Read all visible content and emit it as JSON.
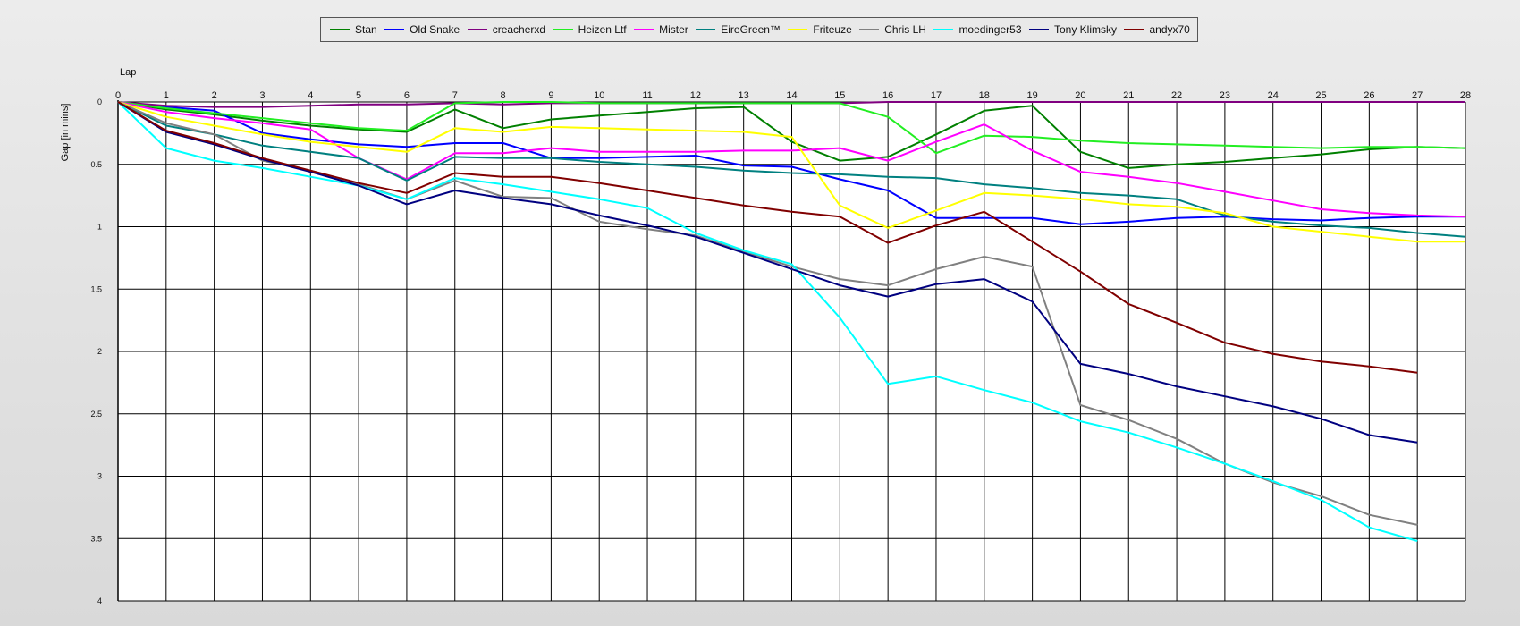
{
  "chart_data": {
    "type": "line",
    "title": "",
    "xlabel": "Lap",
    "ylabel": "Gap [in mins]",
    "xlim": [
      0,
      28
    ],
    "ylim": [
      0,
      4
    ],
    "y_inverted": true,
    "grid": true,
    "legend_position": "top",
    "x_ticks": [
      "0",
      "1",
      "2",
      "3",
      "4",
      "5",
      "6",
      "7",
      "8",
      "9",
      "10",
      "11",
      "12",
      "13",
      "14",
      "15",
      "16",
      "17",
      "18",
      "19",
      "20",
      "21",
      "22",
      "23",
      "24",
      "25",
      "26",
      "27",
      "28"
    ],
    "y_ticks": [
      "0",
      "0.5",
      "1",
      "1.5",
      "2",
      "2.5",
      "3",
      "3.5",
      "4"
    ],
    "series": [
      {
        "name": "Stan",
        "color": "#008000",
        "x": [
          0,
          1,
          2,
          3,
          4,
          5,
          6,
          7,
          8,
          9,
          10,
          11,
          12,
          13,
          14,
          15,
          16,
          17,
          18,
          19,
          20,
          21,
          22,
          23,
          24,
          25,
          26,
          27,
          28
        ],
        "values": [
          0,
          0.06,
          0.1,
          0.15,
          0.19,
          0.22,
          0.24,
          0.06,
          0.21,
          0.14,
          0.11,
          0.08,
          0.05,
          0.04,
          0.32,
          0.47,
          0.44,
          0.26,
          0.07,
          0.03,
          0.4,
          0.53,
          0.5,
          0.48,
          0.45,
          0.42,
          0.38,
          0.36,
          0.37
        ]
      },
      {
        "name": "Old Snake",
        "color": "#0000FF",
        "x": [
          0,
          1,
          2,
          3,
          4,
          5,
          6,
          7,
          8,
          9,
          10,
          11,
          12,
          13,
          14,
          15,
          16,
          17,
          18,
          19,
          20,
          21,
          22,
          23,
          24,
          25,
          26,
          27,
          28
        ],
        "values": [
          0,
          0.04,
          0.07,
          0.25,
          0.3,
          0.34,
          0.36,
          0.33,
          0.33,
          0.45,
          0.45,
          0.44,
          0.43,
          0.51,
          0.52,
          0.62,
          0.71,
          0.93,
          0.93,
          0.93,
          0.98,
          0.96,
          0.93,
          0.92,
          0.94,
          0.95,
          0.93,
          0.92,
          0.92
        ]
      },
      {
        "name": "creacherxd",
        "color": "#800080",
        "x": [
          0,
          1,
          2,
          3,
          4,
          5,
          6,
          7,
          8,
          9,
          10,
          11,
          12,
          13,
          14,
          15,
          16,
          17,
          18,
          19,
          20,
          21,
          22,
          23,
          24,
          25,
          26,
          27,
          28
        ],
        "values": [
          0,
          0.03,
          0.04,
          0.04,
          0.03,
          0.02,
          0.02,
          0.01,
          0.02,
          0.01,
          0.01,
          0.01,
          0.01,
          0.01,
          0.01,
          0.01,
          0,
          0,
          0,
          0,
          0,
          0,
          0,
          0,
          0,
          0,
          0,
          0,
          0
        ]
      },
      {
        "name": "Heizen Ltf",
        "color": "#22EE22",
        "x": [
          0,
          1,
          2,
          3,
          4,
          5,
          6,
          7,
          8,
          9,
          10,
          11,
          12,
          13,
          14,
          15,
          16,
          17,
          18,
          19,
          20,
          21,
          22,
          23,
          24,
          25,
          26,
          27,
          28
        ],
        "values": [
          0,
          0.05,
          0.09,
          0.13,
          0.17,
          0.21,
          0.23,
          0.01,
          0,
          0,
          0.01,
          0.01,
          0.01,
          0.01,
          0.01,
          0.01,
          0.12,
          0.41,
          0.27,
          0.28,
          0.31,
          0.33,
          0.34,
          0.35,
          0.36,
          0.37,
          0.36,
          0.36,
          0.37
        ]
      },
      {
        "name": "Mister",
        "color": "#FF00FF",
        "x": [
          0,
          1,
          2,
          3,
          4,
          5,
          6,
          7,
          8,
          9,
          10,
          11,
          12,
          13,
          14,
          15,
          16,
          17,
          18,
          19,
          20,
          21,
          22,
          23,
          24,
          25,
          26,
          27,
          28
        ],
        "values": [
          0,
          0.08,
          0.13,
          0.17,
          0.22,
          0.45,
          0.62,
          0.41,
          0.41,
          0.37,
          0.4,
          0.4,
          0.4,
          0.39,
          0.39,
          0.37,
          0.47,
          0.32,
          0.18,
          0.39,
          0.56,
          0.6,
          0.65,
          0.72,
          0.79,
          0.86,
          0.89,
          0.91,
          0.92
        ]
      },
      {
        "name": "EireGreen™",
        "color": "#008080",
        "x": [
          0,
          1,
          2,
          3,
          4,
          5,
          6,
          7,
          8,
          9,
          10,
          11,
          12,
          13,
          14,
          15,
          16,
          17,
          18,
          19,
          20,
          21,
          22,
          23,
          24,
          25,
          26,
          27,
          28
        ],
        "values": [
          0,
          0.19,
          0.26,
          0.35,
          0.4,
          0.45,
          0.63,
          0.44,
          0.45,
          0.45,
          0.48,
          0.5,
          0.52,
          0.55,
          0.57,
          0.58,
          0.6,
          0.61,
          0.66,
          0.69,
          0.73,
          0.75,
          0.78,
          0.91,
          0.96,
          0.99,
          1.01,
          1.05,
          1.08
        ]
      },
      {
        "name": "Friteuze",
        "color": "#FFFF00",
        "x": [
          0,
          1,
          2,
          3,
          4,
          5,
          6,
          7,
          8,
          9,
          10,
          11,
          12,
          13,
          14,
          15,
          16,
          17,
          18,
          19,
          20,
          21,
          22,
          23,
          24,
          25,
          26,
          27,
          28
        ],
        "values": [
          0,
          0.12,
          0.19,
          0.26,
          0.32,
          0.36,
          0.4,
          0.21,
          0.24,
          0.2,
          0.21,
          0.22,
          0.23,
          0.24,
          0.28,
          0.83,
          1.01,
          0.87,
          0.73,
          0.75,
          0.78,
          0.82,
          0.84,
          0.89,
          1.0,
          1.04,
          1.08,
          1.12,
          1.12
        ]
      },
      {
        "name": "Chris LH",
        "color": "#808080",
        "x": [
          0,
          1,
          2,
          3,
          4,
          5,
          6,
          7,
          8,
          9,
          10,
          11,
          12,
          13,
          14,
          15,
          16,
          17,
          18,
          19,
          20,
          21,
          22,
          23,
          24,
          25,
          26,
          27
        ],
        "values": [
          0,
          0.17,
          0.26,
          0.47,
          0.55,
          0.66,
          0.78,
          0.63,
          0.76,
          0.77,
          0.96,
          1.02,
          1.07,
          1.2,
          1.32,
          1.42,
          1.47,
          1.34,
          1.24,
          1.32,
          2.43,
          2.55,
          2.7,
          2.9,
          3.05,
          3.16,
          3.31,
          3.39
        ]
      },
      {
        "name": "moedinger53",
        "color": "#00FFFF",
        "x": [
          0,
          1,
          2,
          3,
          4,
          5,
          6,
          7,
          8,
          9,
          10,
          11,
          12,
          13,
          14,
          15,
          16,
          17,
          18,
          19,
          20,
          21,
          22,
          23,
          24,
          25,
          26,
          27
        ],
        "values": [
          0,
          0.37,
          0.47,
          0.53,
          0.6,
          0.67,
          0.78,
          0.61,
          0.66,
          0.72,
          0.78,
          0.85,
          1.05,
          1.19,
          1.3,
          1.73,
          2.26,
          2.2,
          2.31,
          2.41,
          2.56,
          2.65,
          2.77,
          2.9,
          3.04,
          3.19,
          3.41,
          3.52
        ]
      },
      {
        "name": "Tony Klimsky",
        "color": "#000080",
        "x": [
          0,
          1,
          2,
          3,
          4,
          5,
          6,
          7,
          8,
          9,
          10,
          11,
          12,
          13,
          14,
          15,
          16,
          17,
          18,
          19,
          20,
          21,
          22,
          23,
          24,
          25,
          26,
          27
        ],
        "values": [
          0,
          0.24,
          0.34,
          0.46,
          0.56,
          0.67,
          0.82,
          0.71,
          0.77,
          0.82,
          0.91,
          0.99,
          1.08,
          1.21,
          1.34,
          1.47,
          1.56,
          1.46,
          1.42,
          1.6,
          2.1,
          2.18,
          2.28,
          2.36,
          2.44,
          2.54,
          2.67,
          2.73
        ]
      },
      {
        "name": "andyx70",
        "color": "#800000",
        "x": [
          0,
          1,
          2,
          3,
          4,
          5,
          6,
          7,
          8,
          9,
          10,
          11,
          12,
          13,
          14,
          15,
          16,
          17,
          18,
          19,
          20,
          21,
          22,
          23,
          24,
          25,
          26,
          27
        ],
        "values": [
          0,
          0.23,
          0.33,
          0.45,
          0.55,
          0.65,
          0.73,
          0.57,
          0.6,
          0.6,
          0.65,
          0.71,
          0.77,
          0.83,
          0.88,
          0.92,
          1.13,
          0.99,
          0.88,
          1.12,
          1.36,
          1.62,
          1.77,
          1.93,
          2.02,
          2.08,
          2.12,
          2.17
        ]
      }
    ]
  }
}
